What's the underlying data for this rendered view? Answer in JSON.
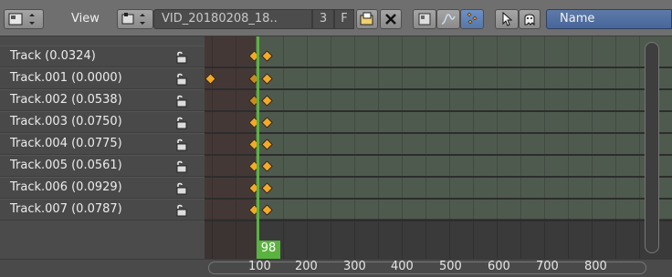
{
  "header": {
    "view_label": "View",
    "clip_name": "VID_20180208_18..",
    "users": "3",
    "fake_user": "F",
    "name_dropdown": "Name"
  },
  "tracks": [
    {
      "label": "Track (0.0324)",
      "key_frames": [
        98,
        101
      ],
      "locked": false
    },
    {
      "label": "Track.001 (0.0000)",
      "key_frames": [
        98,
        101
      ],
      "locked": false,
      "extra_left_key": true
    },
    {
      "label": "Track.002 (0.0538)",
      "key_frames": [
        98,
        101
      ],
      "locked": false
    },
    {
      "label": "Track.003 (0.0750)",
      "key_frames": [
        98,
        101
      ],
      "locked": false
    },
    {
      "label": "Track.004 (0.0775)",
      "key_frames": [
        98,
        101
      ],
      "locked": false
    },
    {
      "label": "Track.005 (0.0561)",
      "key_frames": [
        98,
        101
      ],
      "locked": false
    },
    {
      "label": "Track.006 (0.0929)",
      "key_frames": [
        98,
        101
      ],
      "locked": false
    },
    {
      "label": "Track.007 (0.0787)",
      "key_frames": [
        98,
        101
      ],
      "locked": false
    }
  ],
  "timeline": {
    "current_frame": "98",
    "ruler_ticks": [
      "100",
      "200",
      "300",
      "400",
      "500",
      "600",
      "700",
      "800"
    ]
  },
  "colors": {
    "keyframe": "#f2a928",
    "current_frame": "#5ab33e",
    "dropdown": "#5d7aa8"
  },
  "icons": [
    "editor-type-icon",
    "clip-browse-icon",
    "open-file-icon",
    "close-icon",
    "filter-icon",
    "curve-icon",
    "dopesheet-icon",
    "cursor-icon",
    "ghost-icon",
    "lock-icon",
    "keyframe-icon"
  ]
}
